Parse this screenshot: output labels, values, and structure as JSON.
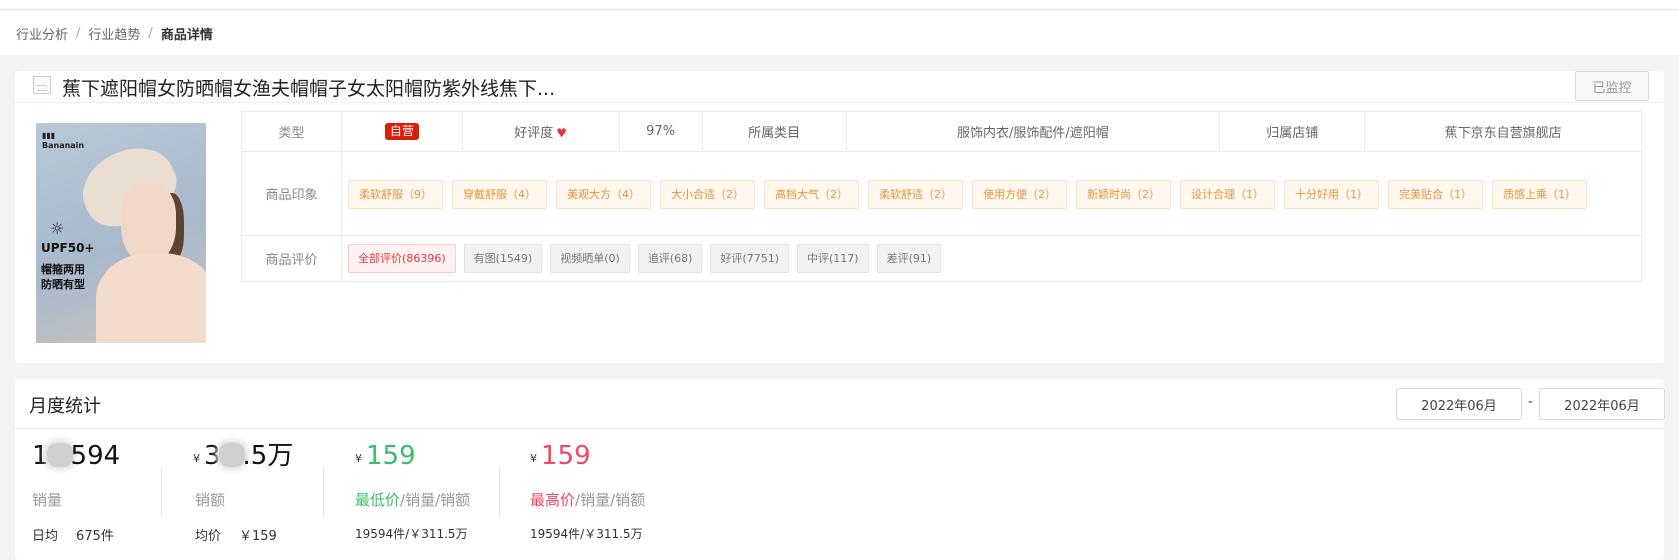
{
  "breadcrumb": {
    "items": [
      "行业分析",
      "行业趋势"
    ],
    "separator": "/",
    "current": "商品详情"
  },
  "product": {
    "title": "蕉下遮阳帽女防晒帽女渔夫帽帽子女太阳帽防紫外线焦下...",
    "monitor_label": "已监控",
    "image": {
      "upf_text": "UPF50+",
      "desc_line1": "帽箍两用",
      "desc_line2": "防晒有型",
      "brand_text": "Bananain"
    },
    "info": {
      "type_label": "类型",
      "type_badge": "自营",
      "rating_label": "好评度",
      "rating_value": "97%",
      "category_label": "所属类目",
      "category_value": "服饰内衣/服饰配件/遮阳帽",
      "shop_label": "归属店铺",
      "shop_value": "蕉下京东自营旗舰店",
      "impression_label": "商品印象",
      "review_label": "商品评价"
    },
    "impressions": [
      "柔软舒服（9）",
      "穿戴舒服（4）",
      "美观大方（4）",
      "大小合适（2）",
      "高档大气（2）",
      "柔软舒适（2）",
      "使用方便（2）",
      "新颖时尚（2）",
      "设计合理（1）",
      "十分好用（1）",
      "完美贴合（1）",
      "质感上乘（1）"
    ],
    "reviews": [
      {
        "label": "全部评价(86396)",
        "active": true
      },
      {
        "label": "有图(1549)",
        "active": false
      },
      {
        "label": "视频晒单(0)",
        "active": false
      },
      {
        "label": "追评(68)",
        "active": false
      },
      {
        "label": "好评(7751)",
        "active": false
      },
      {
        "label": "中评(117)",
        "active": false
      },
      {
        "label": "差评(91)",
        "active": false
      }
    ]
  },
  "monthly": {
    "title": "月度统计",
    "date_from": "2022年06月",
    "date_to": "2022年06月",
    "date_separator": "-",
    "sales": {
      "value_prefix": "1",
      "value_suffix": "594",
      "label": "销量",
      "daily_label": "日均",
      "daily_value": "675件"
    },
    "revenue": {
      "currency": "¥",
      "value_prefix": "3",
      "value_suffix": ".5万",
      "label": "销额",
      "avg_label": "均价",
      "avg_value": "￥159"
    },
    "min_price": {
      "currency": "¥",
      "value": "159",
      "label_strong": "最低价",
      "label_rest": "/销量/销额",
      "sub": "19594件/￥311.5万"
    },
    "max_price": {
      "currency": "¥",
      "value": "159",
      "label_strong": "最高价",
      "label_rest": "/销量/销额",
      "sub": "19594件/￥311.5万"
    }
  },
  "colors": {
    "self_badge": "#d81e06",
    "heart": "#e4393c",
    "impression_text": "#e8933e",
    "min_price": "#3dbb68",
    "max_price": "#ef4864"
  }
}
